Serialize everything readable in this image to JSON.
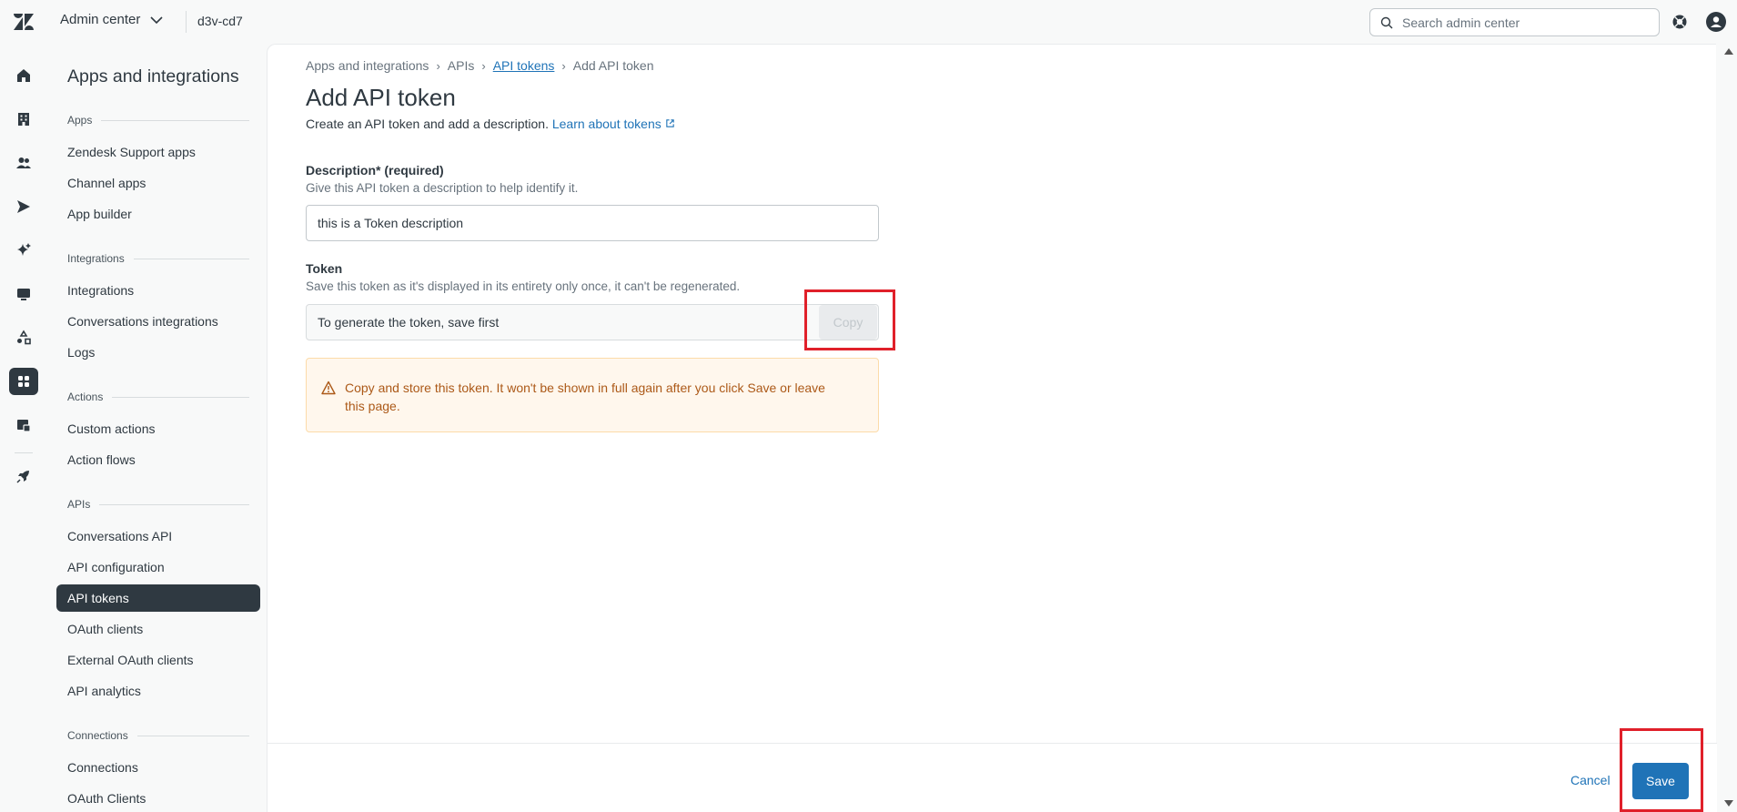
{
  "topbar": {
    "product_label": "Admin center",
    "account_label": "d3v-cd7",
    "search_placeholder": "Search admin center"
  },
  "sidebar": {
    "title": "Apps and integrations",
    "groups": [
      {
        "label": "Apps",
        "items": [
          "Zendesk Support apps",
          "Channel apps",
          "App builder"
        ]
      },
      {
        "label": "Integrations",
        "items": [
          "Integrations",
          "Conversations integrations",
          "Logs"
        ]
      },
      {
        "label": "Actions",
        "items": [
          "Custom actions",
          "Action flows"
        ]
      },
      {
        "label": "APIs",
        "items": [
          "Conversations API",
          "API configuration",
          "API tokens",
          "OAuth clients",
          "External OAuth clients",
          "API analytics"
        ]
      },
      {
        "label": "Connections",
        "items": [
          "Connections",
          "OAuth Clients"
        ]
      }
    ],
    "active_item": "API tokens"
  },
  "breadcrumb": {
    "items": [
      "Apps and integrations",
      "APIs",
      "API tokens",
      "Add API token"
    ]
  },
  "page": {
    "title": "Add API token",
    "subtitle": "Create an API token and add a description.",
    "learn_link": "Learn about tokens"
  },
  "form": {
    "description_label": "Description* (required)",
    "description_hint": "Give this API token a description to help identify it.",
    "description_value": "this is a Token description",
    "token_label": "Token",
    "token_hint": "Save this token as it's displayed in its entirety only once, it can't be regenerated.",
    "token_value": "To generate the token, save first",
    "copy_label": "Copy"
  },
  "alert": {
    "text": "Copy and store this token. It won't be shown in full again after you click Save or leave this page."
  },
  "footer": {
    "cancel_label": "Cancel",
    "save_label": "Save"
  },
  "colors": {
    "accent": "#1f73b7",
    "active_nav": "#2f3941",
    "warning_text": "#ac5918",
    "warning_bg": "#fff7ed",
    "highlight": "#e0202a"
  },
  "icons": [
    "zendesk-logo-icon",
    "chevron-down-icon",
    "search-icon",
    "help-icon",
    "user-avatar-icon",
    "home-icon",
    "building-icon",
    "people-icon",
    "send-icon",
    "sparkle-icon",
    "monitor-icon",
    "objects-icon",
    "apps-grid-icon",
    "workspace-icon",
    "rocket-icon",
    "sidebar-toggle-icon",
    "external-link-icon",
    "warning-icon"
  ]
}
